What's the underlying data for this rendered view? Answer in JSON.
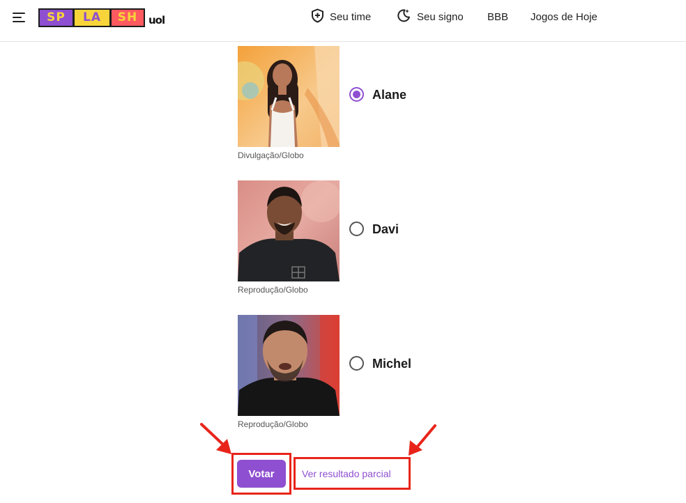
{
  "header": {
    "logo": {
      "part1": "SP",
      "part2": "LA",
      "part3": "SH",
      "brand": "uol",
      "icon": "splash-logo"
    },
    "nav": [
      {
        "label": "Seu time",
        "icon": "shield-plus-icon"
      },
      {
        "label": "Seu signo",
        "icon": "moon-stars-icon"
      },
      {
        "label": "BBB"
      },
      {
        "label": "Jogos de Hoje"
      }
    ]
  },
  "poll": {
    "options": [
      {
        "name": "Alane",
        "credit": "Divulgação/Globo",
        "selected": true
      },
      {
        "name": "Davi",
        "credit": "Reprodução/Globo",
        "selected": false
      },
      {
        "name": "Michel",
        "credit": "Reprodução/Globo",
        "selected": false
      }
    ],
    "vote_label": "Votar",
    "result_label": "Ver resultado parcial"
  },
  "colors": {
    "accent": "#8e4fd0",
    "highlight": "#e8241a"
  }
}
